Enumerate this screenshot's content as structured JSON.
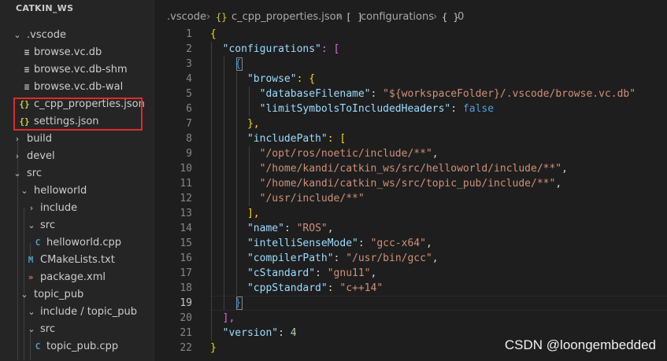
{
  "explorer": {
    "title": "CATKIN_WS",
    "items": [
      {
        "label": ".vscode",
        "chev": "⌄",
        "icon": ""
      },
      {
        "label": "browse.vc.db",
        "chev": "",
        "icon": "≡"
      },
      {
        "label": "browse.vc.db-shm",
        "chev": "",
        "icon": "≡"
      },
      {
        "label": "browse.vc.db-wal",
        "chev": "",
        "icon": "≡"
      },
      {
        "label": "c_cpp_properties.json",
        "chev": "",
        "icon": "{}"
      },
      {
        "label": "settings.json",
        "chev": "",
        "icon": "{}"
      },
      {
        "label": "build",
        "chev": "›",
        "icon": ""
      },
      {
        "label": "devel",
        "chev": "›",
        "icon": ""
      },
      {
        "label": "src",
        "chev": "⌄",
        "icon": ""
      },
      {
        "label": "helloworld",
        "chev": "⌄",
        "icon": ""
      },
      {
        "label": "include",
        "chev": "›",
        "icon": ""
      },
      {
        "label": "src",
        "chev": "⌄",
        "icon": ""
      },
      {
        "label": "helloworld.cpp",
        "chev": "",
        "icon": "C"
      },
      {
        "label": "CMakeLists.txt",
        "chev": "",
        "icon": "M"
      },
      {
        "label": "package.xml",
        "chev": "",
        "icon": "»"
      },
      {
        "label": "topic_pub",
        "chev": "⌄",
        "icon": ""
      },
      {
        "label": "include / topic_pub",
        "chev": "⌄",
        "icon": ""
      },
      {
        "label": "src",
        "chev": "⌄",
        "icon": ""
      },
      {
        "label": "topic_pub.cpp",
        "chev": "",
        "icon": "C"
      }
    ]
  },
  "breadcrumb": {
    "folder": ".vscode",
    "sep1": "›",
    "file_icon": "{}",
    "file": "c_cpp_properties.json",
    "sep2": "›",
    "sym1_icon": "[ ]",
    "sym1": "configurations",
    "sep3": "›",
    "sym2_icon": "{ }",
    "sym2": "0"
  },
  "editor": {
    "line_numbers": [
      "1",
      "2",
      "3",
      "4",
      "5",
      "6",
      "7",
      "8",
      "9",
      "10",
      "11",
      "12",
      "13",
      "14",
      "15",
      "16",
      "17",
      "18",
      "19",
      "20",
      "21",
      "22"
    ],
    "active_line": "19",
    "code": {
      "l1_open": "{",
      "l2_key": "\"configurations\"",
      "l2_rest": ": [",
      "l3_open": "{",
      "l4_key": "\"browse\"",
      "l4_rest": ": {",
      "l5_key": "\"databaseFilename\"",
      "l5_colon": ": ",
      "l5_val": "\"${workspaceFolder}/.vscode/browse.vc.db\"",
      "l6_key": "\"limitSymbolsToIncludedHeaders\"",
      "l6_colon": ": ",
      "l6_val": "false",
      "l7": "},",
      "l8_key": "\"includePath\"",
      "l8_rest": ": [",
      "l9_val": "\"/opt/ros/noetic/include/**\"",
      "l9_comma": ",",
      "l10_val": "\"/home/kandi/catkin_ws/src/helloworld/include/**\"",
      "l10_comma": ",",
      "l11_val": "\"/home/kandi/catkin_ws/src/topic_pub/include/**\"",
      "l11_comma": ",",
      "l12_val": "\"/usr/include/**\"",
      "l13": "],",
      "l14_key": "\"name\"",
      "l14_colon": ": ",
      "l14_val": "\"ROS\"",
      "l14_comma": ",",
      "l15_key": "\"intelliSenseMode\"",
      "l15_colon": ": ",
      "l15_val": "\"gcc-x64\"",
      "l15_comma": ",",
      "l16_key": "\"compilerPath\"",
      "l16_colon": ": ",
      "l16_val": "\"/usr/bin/gcc\"",
      "l16_comma": ",",
      "l17_key": "\"cStandard\"",
      "l17_colon": ": ",
      "l17_val": "\"gnu11\"",
      "l17_comma": ",",
      "l18_key": "\"cppStandard\"",
      "l18_colon": ": ",
      "l18_val": "\"c++14\"",
      "l19_close": "}",
      "l20": "],",
      "l21_key": "\"version\"",
      "l21_colon": ": ",
      "l21_val": "4",
      "l22_close": "}"
    }
  },
  "watermark": "CSDN @loongembedded",
  "colors": {
    "editor_bg": "#1e1e1e",
    "sidebar_bg": "#252526",
    "highlight_box": "#e02a2a",
    "json_key": "#9cdcfe",
    "json_string": "#ce9178",
    "json_number": "#b5cea8",
    "json_keyword": "#569cd6"
  }
}
